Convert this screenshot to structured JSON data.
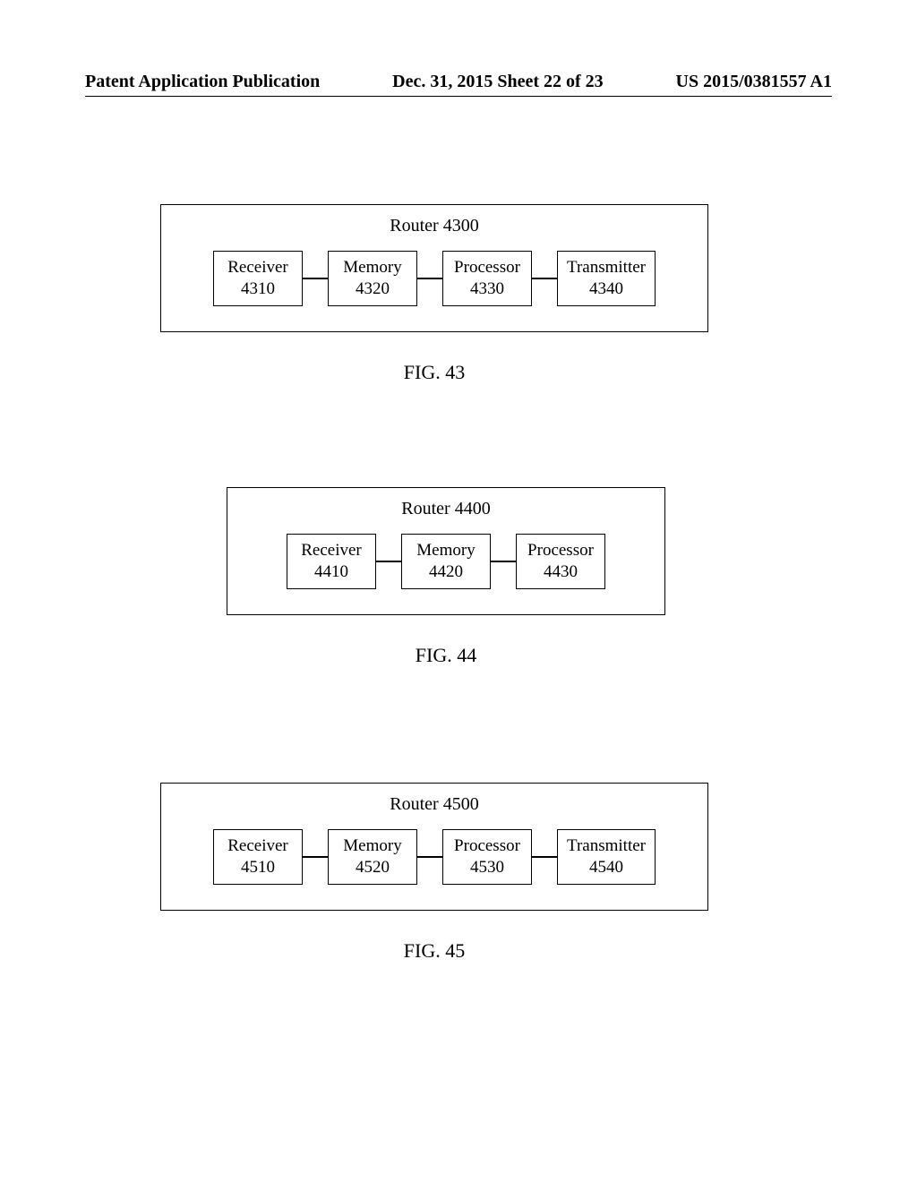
{
  "header": {
    "left": "Patent Application Publication",
    "mid": "Dec. 31, 2015  Sheet 22 of 23",
    "right": "US 2015/0381557 A1"
  },
  "figures": {
    "f43": {
      "outer_title": "Router 4300",
      "blocks": [
        "Receiver\n4310",
        "Memory\n4320",
        "Processor\n4330",
        "Transmitter\n4340"
      ],
      "caption": "FIG. 43"
    },
    "f44": {
      "outer_title": "Router 4400",
      "blocks": [
        "Receiver\n4410",
        "Memory\n4420",
        "Processor\n4430"
      ],
      "caption": "FIG. 44"
    },
    "f45": {
      "outer_title": "Router 4500",
      "blocks": [
        "Receiver\n4510",
        "Memory\n4520",
        "Processor\n4530",
        "Transmitter\n4540"
      ],
      "caption": "FIG. 45"
    }
  },
  "chart_data": [
    {
      "type": "diagram",
      "title": "Router 4300",
      "nodes": [
        {
          "id": "4310",
          "label": "Receiver"
        },
        {
          "id": "4320",
          "label": "Memory"
        },
        {
          "id": "4330",
          "label": "Processor"
        },
        {
          "id": "4340",
          "label": "Transmitter"
        }
      ],
      "edges": [
        [
          "4310",
          "4320"
        ],
        [
          "4320",
          "4330"
        ],
        [
          "4330",
          "4340"
        ]
      ],
      "caption": "FIG. 43"
    },
    {
      "type": "diagram",
      "title": "Router 4400",
      "nodes": [
        {
          "id": "4410",
          "label": "Receiver"
        },
        {
          "id": "4420",
          "label": "Memory"
        },
        {
          "id": "4430",
          "label": "Processor"
        }
      ],
      "edges": [
        [
          "4410",
          "4420"
        ],
        [
          "4420",
          "4430"
        ]
      ],
      "caption": "FIG. 44"
    },
    {
      "type": "diagram",
      "title": "Router 4500",
      "nodes": [
        {
          "id": "4510",
          "label": "Receiver"
        },
        {
          "id": "4520",
          "label": "Memory"
        },
        {
          "id": "4530",
          "label": "Processor"
        },
        {
          "id": "4540",
          "label": "Transmitter"
        }
      ],
      "edges": [
        [
          "4510",
          "4520"
        ],
        [
          "4520",
          "4530"
        ],
        [
          "4530",
          "4540"
        ]
      ],
      "caption": "FIG. 45"
    }
  ]
}
